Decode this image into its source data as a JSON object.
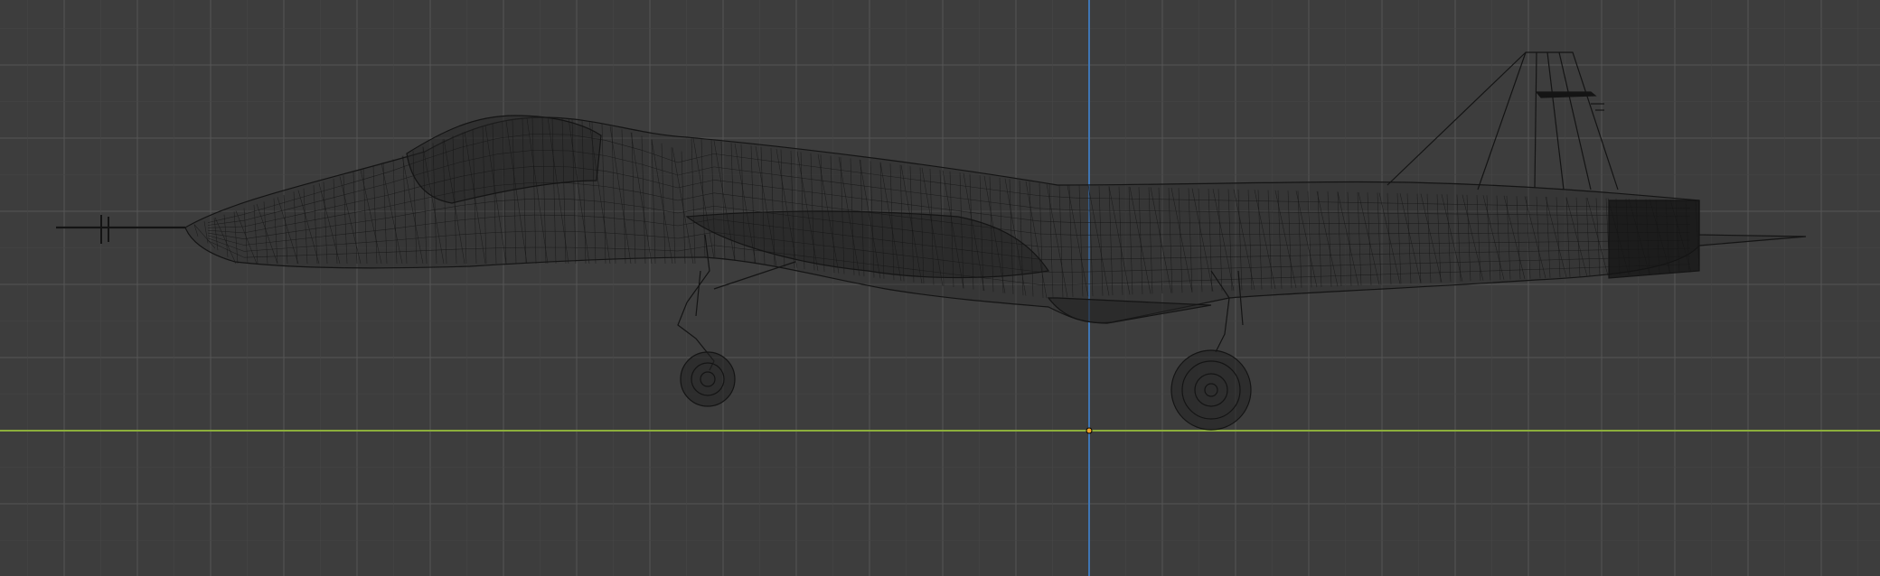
{
  "viewport": {
    "view": "side-orthographic",
    "shading": "wireframe",
    "grid": true
  },
  "colors": {
    "background": "#3d3d3d",
    "grid_minor": "#474747",
    "grid_major": "#555555",
    "x_axis": "#8cae3c",
    "z_axis": "#3f76b4",
    "wire": "#141414",
    "origin": "#f0a12a"
  },
  "object": {
    "name": "fighter-jet-wireframe-icon"
  }
}
